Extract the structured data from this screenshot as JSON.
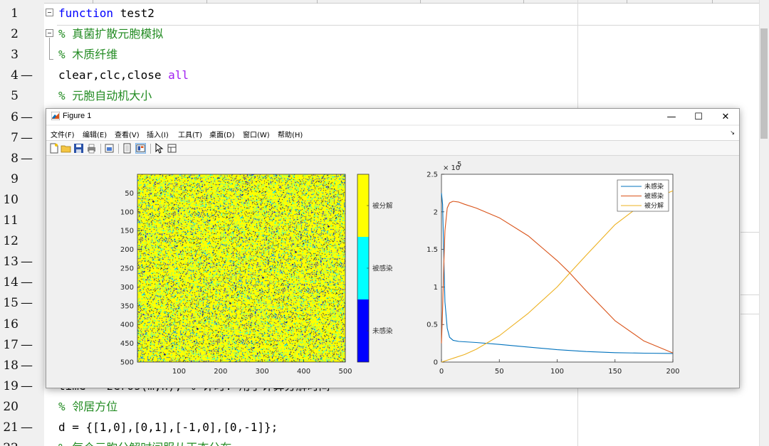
{
  "editor": {
    "lines": [
      {
        "n": "1",
        "dash": false,
        "code": [
          {
            "t": "function",
            "c": "kw"
          },
          {
            "t": " test2",
            "c": ""
          }
        ]
      },
      {
        "n": "2",
        "dash": false,
        "code": [
          {
            "t": "% 真菌扩散元胞模拟",
            "c": "cm"
          }
        ]
      },
      {
        "n": "3",
        "dash": false,
        "code": [
          {
            "t": "% 木质纤维",
            "c": "cm"
          }
        ]
      },
      {
        "n": "4",
        "dash": true,
        "code": [
          {
            "t": "clear,clc,close ",
            "c": ""
          },
          {
            "t": "all",
            "c": "str"
          }
        ]
      },
      {
        "n": "5",
        "dash": false,
        "code": [
          {
            "t": "% 元胞自动机大小",
            "c": "cm"
          }
        ]
      },
      {
        "n": "6",
        "dash": true,
        "code": []
      },
      {
        "n": "7",
        "dash": true,
        "code": []
      },
      {
        "n": "8",
        "dash": true,
        "code": []
      },
      {
        "n": "9",
        "dash": false,
        "code": []
      },
      {
        "n": "10",
        "dash": false,
        "code": []
      },
      {
        "n": "11",
        "dash": false,
        "code": []
      },
      {
        "n": "12",
        "dash": false,
        "code": []
      },
      {
        "n": "13",
        "dash": true,
        "code": []
      },
      {
        "n": "14",
        "dash": true,
        "code": []
      },
      {
        "n": "15",
        "dash": true,
        "code": []
      },
      {
        "n": "16",
        "dash": false,
        "code": []
      },
      {
        "n": "17",
        "dash": true,
        "code": []
      },
      {
        "n": "18",
        "dash": true,
        "code": []
      },
      {
        "n": "19",
        "dash": true,
        "code": [
          {
            "t": "time = zeros(m,n); % 计时: 用于计算分解时间",
            "c": ""
          }
        ]
      },
      {
        "n": "20",
        "dash": false,
        "code": [
          {
            "t": "% 邻居方位",
            "c": "cm"
          }
        ]
      },
      {
        "n": "21",
        "dash": true,
        "code": [
          {
            "t": "d = {[1,0],[0,1],[-1,0],[0,-1]};",
            "c": ""
          }
        ]
      },
      {
        "n": "22",
        "dash": false,
        "code": [
          {
            "t": "% 每个元胞分解时间服从正态分布",
            "c": "cm"
          }
        ]
      }
    ]
  },
  "figure": {
    "title": "Figure 1",
    "window_buttons": {
      "minimize": "—",
      "maximize": "☐",
      "close": "✕"
    },
    "menu": [
      "文件(F)",
      "编辑(E)",
      "查看(V)",
      "插入(I)",
      "工具(T)",
      "桌面(D)",
      "窗口(W)",
      "帮助(H)"
    ],
    "menu_arrow": "↘",
    "toolbar": [
      "new-figure",
      "open-file",
      "save",
      "print",
      "print-preview",
      "hide-plot-tools",
      "show-plot-tools",
      "edit-plot",
      "inspector"
    ]
  },
  "colors": {
    "yellow": "#ffff00",
    "cyan": "#00ffff",
    "blue": "#0000ff",
    "dark": "#0a0a3a",
    "line_blue": "#0072bd",
    "line_orange": "#d95319",
    "line_yellow": "#edb120"
  },
  "chart_data": [
    {
      "type": "heatmap",
      "description_categories": [
        "未感染",
        "被感染",
        "被分解"
      ],
      "yticks": [
        "50",
        "100",
        "150",
        "200",
        "250",
        "300",
        "350",
        "400",
        "450",
        "500"
      ],
      "xticks": [
        "100",
        "200",
        "300",
        "400",
        "500"
      ],
      "xlim": [
        0,
        500
      ],
      "ylim": [
        0,
        500
      ],
      "colorbar_labels": [
        "被分解",
        "被感染",
        "未感染"
      ],
      "fractions": {
        "被分解": 0.82,
        "被感染": 0.09,
        "未感染": 0.05,
        "other": 0.04
      }
    },
    {
      "type": "line",
      "exponent_label": "× 10",
      "exponent_power": "5",
      "xlim": [
        0,
        200
      ],
      "ylim": [
        0,
        2.5
      ],
      "xticks": [
        "0",
        "50",
        "100",
        "150",
        "200"
      ],
      "yticks": [
        "0",
        "0.5",
        "1",
        "1.5",
        "2",
        "2.5"
      ],
      "legend": [
        "未感染",
        "被感染",
        "被分解"
      ],
      "series": [
        {
          "name": "未感染",
          "x": [
            0,
            1,
            2,
            3,
            5,
            7,
            10,
            15,
            20,
            30,
            50,
            75,
            100,
            125,
            150,
            175,
            200
          ],
          "values": [
            2.25,
            2.1,
            1.4,
            0.8,
            0.45,
            0.33,
            0.29,
            0.275,
            0.27,
            0.26,
            0.235,
            0.2,
            0.165,
            0.14,
            0.125,
            0.118,
            0.115
          ]
        },
        {
          "name": "被感染",
          "x": [
            0,
            1,
            2,
            3,
            5,
            7,
            10,
            15,
            20,
            30,
            50,
            75,
            100,
            110,
            125,
            150,
            175,
            200
          ],
          "values": [
            0.25,
            0.7,
            1.3,
            1.75,
            2.05,
            2.12,
            2.14,
            2.13,
            2.1,
            2.05,
            1.92,
            1.68,
            1.35,
            1.2,
            0.95,
            0.55,
            0.28,
            0.12
          ]
        },
        {
          "name": "被分解",
          "x": [
            0,
            10,
            20,
            30,
            50,
            75,
            100,
            110,
            125,
            150,
            175,
            200
          ],
          "values": [
            0,
            0.05,
            0.1,
            0.17,
            0.35,
            0.65,
            1.0,
            1.17,
            1.42,
            1.83,
            2.12,
            2.28
          ]
        }
      ]
    }
  ]
}
